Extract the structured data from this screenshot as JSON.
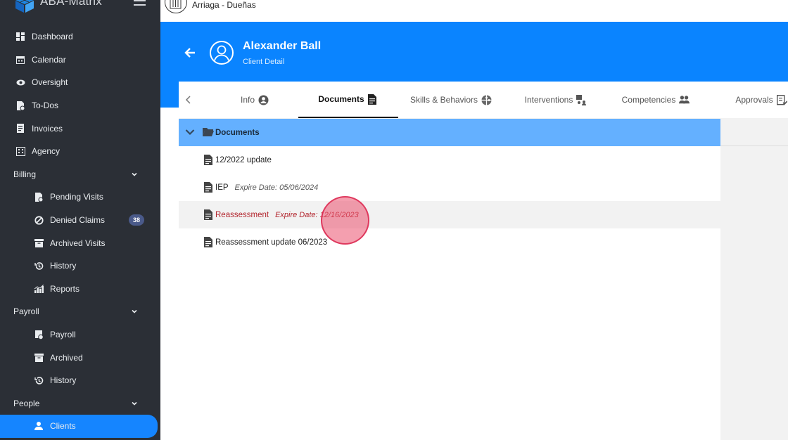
{
  "app": {
    "brand": "ABA-Matrix",
    "org_name": "Arriaga - Dueñas"
  },
  "sidebar": {
    "items": [
      {
        "label": "Dashboard",
        "icon": "dashboard-icon"
      },
      {
        "label": "Calendar",
        "icon": "calendar-icon"
      },
      {
        "label": "Oversight",
        "icon": "eye-icon"
      },
      {
        "label": "To-Dos",
        "icon": "todo-icon"
      },
      {
        "label": "Invoices",
        "icon": "invoice-icon"
      },
      {
        "label": "Agency",
        "icon": "agency-icon"
      }
    ],
    "billing": {
      "label": "Billing",
      "items": [
        {
          "label": "Pending Visits",
          "icon": "pending-icon"
        },
        {
          "label": "Denied Claims",
          "icon": "denied-icon",
          "badge": "38"
        },
        {
          "label": "Archived Visits",
          "icon": "archive-icon"
        },
        {
          "label": "History",
          "icon": "history-icon"
        },
        {
          "label": "Reports",
          "icon": "reports-icon"
        }
      ]
    },
    "payroll": {
      "label": "Payroll",
      "items": [
        {
          "label": "Payroll",
          "icon": "payroll-icon"
        },
        {
          "label": "Archived",
          "icon": "archive-icon"
        },
        {
          "label": "History",
          "icon": "history-icon"
        }
      ]
    },
    "people": {
      "label": "People",
      "items": [
        {
          "label": "Clients",
          "icon": "person-icon",
          "active": true
        }
      ]
    }
  },
  "header": {
    "client_name": "Alexander Ball",
    "subtitle": "Client Detail"
  },
  "tabs": [
    {
      "label": "Info",
      "icon": "account-circle-icon"
    },
    {
      "label": "Documents",
      "icon": "document-icon",
      "active": true
    },
    {
      "label": "Skills & Behaviors",
      "icon": "puzzle-icon"
    },
    {
      "label": "Interventions",
      "icon": "interventions-icon"
    },
    {
      "label": "Competencies",
      "icon": "group-icon"
    },
    {
      "label": "Approvals",
      "icon": "approvals-icon"
    }
  ],
  "documents": {
    "folder_label": "Documents",
    "items": [
      {
        "name": "12/2022 update",
        "expire": ""
      },
      {
        "name": "IEP",
        "expire": "Expire Date: 05/06/2024"
      },
      {
        "name": "Reassessment",
        "expire": "Expire Date: 12/16/2023",
        "highlighted": true
      },
      {
        "name": "Reassessment update 06/2023",
        "expire": ""
      }
    ]
  },
  "colors": {
    "sidebar_bg": "#2b2f36",
    "accent": "#0a84ff",
    "active_nav": "#1585ff",
    "folder_row": "#64b0ff",
    "highlight_text": "#b3262e"
  }
}
